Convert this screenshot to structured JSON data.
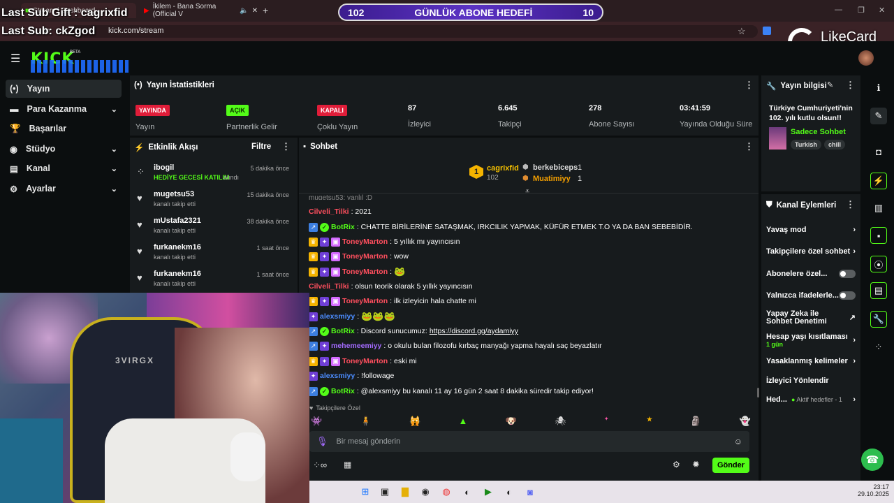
{
  "browser": {
    "tabs": [
      {
        "label": "Stream | Dashboard"
      },
      {
        "label": "İkilem - Bana Sorma (Official V"
      }
    ],
    "url": "kick.com/stream",
    "new_tab": "+"
  },
  "overlay": {
    "last_sub_gift": "Last Sub Gift : cagrixfid",
    "last_sub": "Last Sub: ckZgod",
    "goal_left": "102",
    "goal_title": "GÜNLÜK ABONE HEDEFİ",
    "goal_right": "10",
    "likecard": "LikeCard"
  },
  "nav": {
    "brand": "KICK",
    "brand_badge": "BETA",
    "items": [
      {
        "label": "Yayın"
      },
      {
        "label": "Para Kazanma"
      },
      {
        "label": "Başarılar"
      },
      {
        "label": "Stüdyo"
      },
      {
        "label": "Kanal"
      },
      {
        "label": "Ayarlar"
      }
    ]
  },
  "stats": {
    "title": "Yayın İstatistikleri",
    "items": [
      {
        "badge": "YAYINDA",
        "label": "Yayın"
      },
      {
        "badge": "AÇIK",
        "label": "Partnerlik Gelir"
      },
      {
        "badge": "KAPALI",
        "label": "Çoklu Yayın"
      },
      {
        "value": "87",
        "label": "İzleyici"
      },
      {
        "value": "6.645",
        "label": "Takipçi"
      },
      {
        "value": "278",
        "label": "Abone Sayısı"
      },
      {
        "value": "03:41:59",
        "label": "Yayında Olduğu Süre"
      }
    ]
  },
  "activity": {
    "title": "Etkinlik Akışı",
    "filter": "Filtre",
    "items": [
      {
        "name": "ibogil",
        "sub": "HEDİYE GECESİ KATILIM",
        "sub2": "alındı",
        "time": "5 dakika önce"
      },
      {
        "name": "mugetsu53",
        "sub": "kanalı takip etti",
        "time": "15 dakika önce"
      },
      {
        "name": "mUstafa2321",
        "sub": "kanalı takip etti",
        "time": "38 dakika önce"
      },
      {
        "name": "furkanekm16",
        "sub": "kanalı takip etti",
        "time": "1 saat önce"
      },
      {
        "name": "furkanekm16",
        "sub": "kanalı takip etti",
        "time": "1 saat önce"
      }
    ]
  },
  "chat": {
    "title": "Sohbet",
    "leader1_rank": "1",
    "leader1_name": "cagrixfid",
    "leader1_count": "102",
    "leader2_name": "berkebiceps",
    "leader2_count": "1",
    "leader3_name": "Muatimiyy",
    "leader3_count": "1",
    "partial_line": "mugetsu53: yanlıl :D",
    "messages": [
      {
        "user": "Cilveli_Tilki",
        "text": ": 2021",
        "style": "red"
      },
      {
        "user": "BotRix",
        "text": ": CHATTE BİRİLERİNE SATAŞMAK, IRKCILIK YAPMAK, KÜFÜR ETMEK T.O YA DA BAN SEBEBİDİR.",
        "style": "green"
      },
      {
        "user": "ToneyMarton",
        "text": ": 5 yıllık mı yayıncısın",
        "style": "red"
      },
      {
        "user": "ToneyMarton",
        "text": ": wow",
        "style": "red"
      },
      {
        "user": "ToneyMarton",
        "text": ":",
        "style": "red"
      },
      {
        "user": "Cilveli_Tilki",
        "text": ": olsun teorik olarak 5 yıllık yayıncısın",
        "style": "red"
      },
      {
        "user": "ToneyMarton",
        "text": ": ilk izleyicin hala chatte mi",
        "style": "red"
      },
      {
        "user": "alexsmiyy",
        "text": ":",
        "style": "blue"
      },
      {
        "user": "BotRix",
        "text": ": Discord sunucumuz: ",
        "link": "https://discord.gg/aydamiyy",
        "style": "green"
      },
      {
        "user": "mehemeemiyy",
        "text": ": o okulu bulan filozofu kırbaç manyağı yapma hayalı saç beyazlatır",
        "style": "purple"
      },
      {
        "user": "ToneyMarton",
        "text": ": eski mi",
        "style": "red"
      },
      {
        "user": "alexsmiyy",
        "text": ": !followage",
        "style": "blue"
      },
      {
        "user": "BotRix",
        "text": ": @alexsmiyy bu kanalı 11 ay 16 gün 2 saat 8 dakika süredir takip ediyor!",
        "style": "green"
      }
    ],
    "followers_only": "Takipçilere Özel",
    "input_placeholder": "Bir mesaj gönderin",
    "send": "Gönder"
  },
  "stream_info": {
    "title": "Yayın bilgisi",
    "stream_title": "Türkiye Cumhuriyeti'nin 102. yılı kutlu olsun!!",
    "category": "Sadece Sohbet",
    "tags": [
      "Turkish",
      "chill"
    ]
  },
  "channel_actions": {
    "title": "Kanal Eylemleri",
    "items": [
      {
        "label": "Yavaş mod"
      },
      {
        "label": "Takipçilere özel sohbet"
      },
      {
        "label": "Abonelere özel..."
      },
      {
        "label": "Yalnızca ifadelerle..."
      },
      {
        "label": "Yapay Zeka ile Sohbet Denetimi"
      },
      {
        "label": "Hesap yaşı kısıtlaması",
        "sub": "1 gün"
      },
      {
        "label": "Yasaklanmış kelimeler"
      },
      {
        "label": "İzleyici Yönlendir"
      },
      {
        "label": "Hed...",
        "sub": "Aktif hedefler - 1"
      }
    ]
  },
  "taskbar": {
    "time": "23:17",
    "date": "29.10.2025"
  }
}
